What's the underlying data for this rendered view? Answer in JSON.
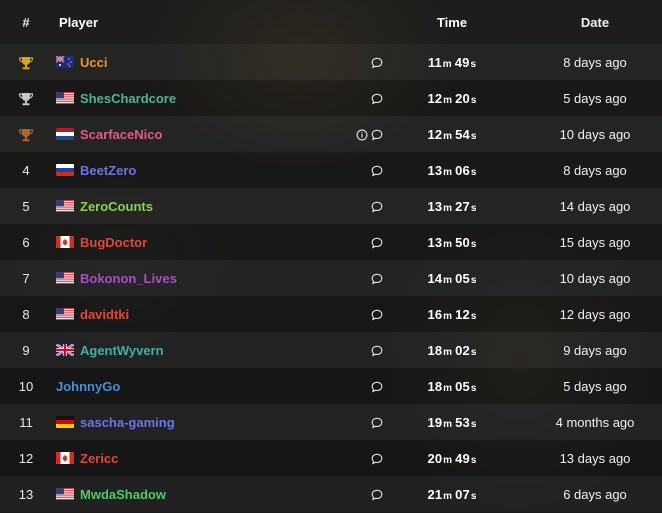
{
  "header": {
    "rank": "#",
    "player": "Player",
    "time": "Time",
    "date": "Date"
  },
  "rows": [
    {
      "rank": "",
      "trophy": "gold",
      "flag": "au",
      "name": "Ucci",
      "color": "#e8933a",
      "min": "11",
      "sec": "49",
      "date": "8 days ago",
      "info": false
    },
    {
      "rank": "",
      "trophy": "silver",
      "flag": "us",
      "name": "ShesChardcore",
      "color": "#4fb39a",
      "min": "12",
      "sec": "20",
      "date": "5 days ago",
      "info": false
    },
    {
      "rank": "",
      "trophy": "bronze",
      "flag": "nl",
      "name": "ScarfaceNico",
      "color": "#e05a8a",
      "min": "12",
      "sec": "54",
      "date": "10 days ago",
      "info": true
    },
    {
      "rank": "4",
      "trophy": "",
      "flag": "ru",
      "name": "BeetZero",
      "color": "#6e74e6",
      "min": "13",
      "sec": "06",
      "date": "8 days ago",
      "info": false
    },
    {
      "rank": "5",
      "trophy": "",
      "flag": "us",
      "name": "ZeroCounts",
      "color": "#8fd14f",
      "min": "13",
      "sec": "27",
      "date": "14 days ago",
      "info": false
    },
    {
      "rank": "6",
      "trophy": "",
      "flag": "ca",
      "name": "BugDoctor",
      "color": "#e0463a",
      "min": "13",
      "sec": "50",
      "date": "15 days ago",
      "info": false
    },
    {
      "rank": "7",
      "trophy": "",
      "flag": "us",
      "name": "Bokonon_Lives",
      "color": "#a64fc8",
      "min": "14",
      "sec": "05",
      "date": "10 days ago",
      "info": false
    },
    {
      "rank": "8",
      "trophy": "",
      "flag": "us",
      "name": "davidtki",
      "color": "#e0463a",
      "min": "16",
      "sec": "12",
      "date": "12 days ago",
      "info": false
    },
    {
      "rank": "9",
      "trophy": "",
      "flag": "gb",
      "name": "AgentWyvern",
      "color": "#3fb0a8",
      "min": "18",
      "sec": "02",
      "date": "9 days ago",
      "info": false
    },
    {
      "rank": "10",
      "trophy": "",
      "flag": "",
      "name": "JohnnyGo",
      "color": "#4a8fd8",
      "min": "18",
      "sec": "05",
      "date": "5 days ago",
      "info": false
    },
    {
      "rank": "11",
      "trophy": "",
      "flag": "de",
      "name": "sascha-gaming",
      "color": "#6e74e6",
      "min": "19",
      "sec": "53",
      "date": "4 months ago",
      "info": false
    },
    {
      "rank": "12",
      "trophy": "",
      "flag": "ca",
      "name": "Zericc",
      "color": "#e0463a",
      "min": "20",
      "sec": "49",
      "date": "13 days ago",
      "info": false
    },
    {
      "rank": "13",
      "trophy": "",
      "flag": "us",
      "name": "MwdaShadow",
      "color": "#4fc86a",
      "min": "21",
      "sec": "07",
      "date": "6 days ago",
      "info": false
    }
  ],
  "units": {
    "minutes": "m",
    "seconds": "s"
  },
  "trophy_colors": {
    "gold": "#d9a12a",
    "silver": "#c8c8c8",
    "bronze": "#b0652e"
  }
}
